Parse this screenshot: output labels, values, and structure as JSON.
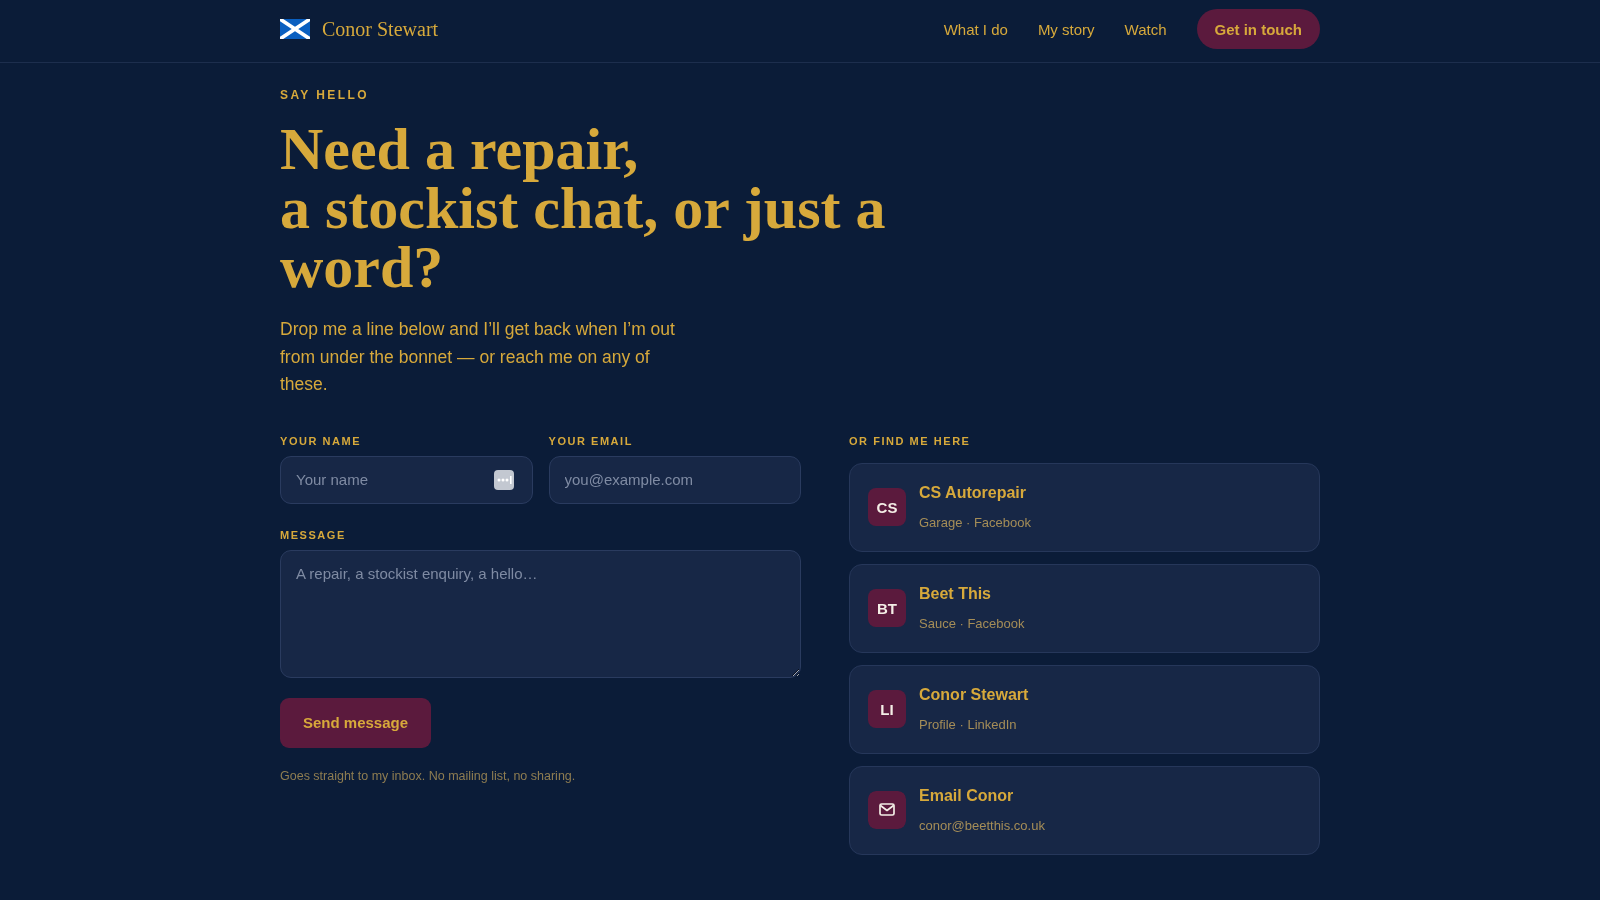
{
  "header": {
    "brand": "Conor Stewart",
    "nav": [
      "What I do",
      "My story",
      "Watch"
    ],
    "cta": "Get in touch"
  },
  "intro": {
    "eyebrow": "SAY HELLO",
    "heading": [
      "Need a repair,",
      "a stockist chat, or just a word?"
    ],
    "text": "Drop me a line below and I’ll get back when I’m out from under the bonnet — or reach me on any of these."
  },
  "form": {
    "fields": [
      {
        "kind": "text",
        "label": "YOUR NAME",
        "placeholder": "Your name",
        "autofill_icon": true
      },
      {
        "kind": "email",
        "label": "YOUR EMAIL",
        "placeholder": "you@example.com"
      },
      {
        "kind": "textarea",
        "label": "MESSAGE",
        "placeholder": "A repair, a stockist enquiry, a hello…"
      }
    ],
    "submit": "Send message",
    "note": "Goes straight to my inbox. No mailing list, no sharing."
  },
  "contacts": {
    "title": "OR FIND ME HERE",
    "items": [
      {
        "kind": "initials",
        "initials": "CS",
        "title": "CS Autorepair",
        "subtitle": "Garage · Facebook"
      },
      {
        "kind": "initials",
        "initials": "BT",
        "title": "Beet This",
        "subtitle": "Sauce · Facebook"
      },
      {
        "kind": "initials",
        "initials": "LI",
        "title": "Conor Stewart",
        "subtitle": "Profile · LinkedIn"
      },
      {
        "kind": "email",
        "title": "Email Conor",
        "subtitle": "conor@beetthis.co.uk"
      }
    ]
  }
}
